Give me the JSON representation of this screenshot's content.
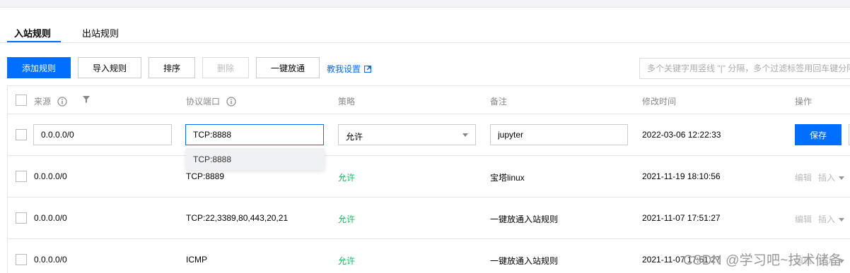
{
  "tabs": [
    {
      "label": "入站规则",
      "active": true
    },
    {
      "label": "出站规则",
      "active": false
    }
  ],
  "toolbar": {
    "add_rule": "添加规则",
    "import_rules": "导入规则",
    "sort": "排序",
    "delete": "删除",
    "one_click_open": "一键放通",
    "help_link": "教我设置",
    "search_placeholder": "多个关键字用竖线 \"|\" 分隔，多个过滤标签用回车键分隔"
  },
  "table": {
    "headers": {
      "source": "来源",
      "protocol_port": "协议端口",
      "policy": "策略",
      "remark": "备注",
      "modified_time": "修改时间",
      "actions": "操作"
    },
    "edit_row": {
      "source": "0.0.0.0/0",
      "protocol_port": "TCP:8888",
      "policy": "允许",
      "remark": "jupyter",
      "modified_time": "2022-03-06 12:22:33",
      "save_label": "保存",
      "suggestion": "TCP:8888"
    },
    "rows": [
      {
        "source": "0.0.0.0/0",
        "protocol_port": "TCP:8889",
        "policy": "允许",
        "remark": "宝塔linux",
        "modified_time": "2021-11-19 18:10:56",
        "edit": "编辑",
        "insert": "插入"
      },
      {
        "source": "0.0.0.0/0",
        "protocol_port": "TCP:22,3389,80,443,20,21",
        "policy": "允许",
        "remark": "一键放通入站规则",
        "modified_time": "2021-11-07 17:51:27",
        "edit": "编辑",
        "insert": "插入"
      },
      {
        "source": "0.0.0.0/0",
        "protocol_port": "ICMP",
        "policy": "允许",
        "remark": "一键放通入站规则",
        "modified_time": "2021-11-07 17:51:27",
        "edit": "编辑",
        "insert": "插入"
      }
    ]
  },
  "watermark": "CSDN @学习吧~技术储备",
  "colors": {
    "accent": "#006eff",
    "allow": "#0abf5b"
  },
  "icons": [
    "info-icon",
    "filter-icon",
    "external-link-icon",
    "chevron-down-icon"
  ]
}
